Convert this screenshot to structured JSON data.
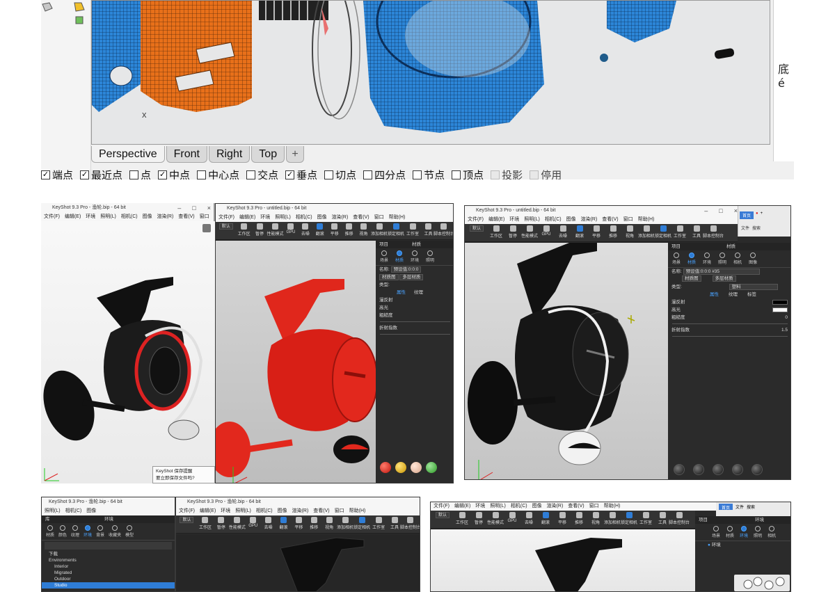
{
  "rhino": {
    "viewport_tabs": [
      "Perspective",
      "Front",
      "Right",
      "Top"
    ],
    "add_tab_glyph": "+",
    "axis_label": "x",
    "right_panel_text": "底é",
    "osnap": [
      {
        "label": "端点",
        "checked": true
      },
      {
        "label": "最近点",
        "checked": true
      },
      {
        "label": "点",
        "checked": false
      },
      {
        "label": "中点",
        "checked": true
      },
      {
        "label": "中心点",
        "checked": false
      },
      {
        "label": "交点",
        "checked": false
      },
      {
        "label": "垂点",
        "checked": true
      },
      {
        "label": "切点",
        "checked": false
      },
      {
        "label": "四分点",
        "checked": false
      },
      {
        "label": "节点",
        "checked": false
      },
      {
        "label": "顶点",
        "checked": false
      },
      {
        "label": "投影",
        "checked": false,
        "disabled": true
      },
      {
        "label": "停用",
        "checked": false,
        "disabled": true
      }
    ],
    "colors": {
      "orange_mesh": "#e8701a",
      "blue_mesh": "#2c86d8",
      "viewport_bg": "#e6e7e8"
    }
  },
  "ks1": {
    "title_left": "KeyShot 9.3 Pro - 渔轮.bip - 64 bit",
    "title_right": "KeyShot 9.3 Pro - untitled.bip - 64 bit",
    "menu_left": [
      "文件(F)",
      "编辑(E)",
      "环境",
      "照明(L)",
      "相机(C)",
      "图像",
      "渲染(R)",
      "查看(V)",
      "窗口"
    ],
    "menu_right": [
      "文件(F)",
      "编辑(E)",
      "环境",
      "照明(L)",
      "相机(C)",
      "图像",
      "渲染(R)",
      "查看(V)",
      "窗口",
      "帮助(H)"
    ],
    "toolbar": {
      "default_label": "默认",
      "resolution": "50.0",
      "buttons": [
        "工作区",
        "暂停",
        "性能模式",
        "GPU",
        "去噪",
        "翻滚",
        "平移",
        "推移",
        "视角",
        "添加相机",
        "锁定相机",
        "工作室",
        "工具",
        "脚本控制台"
      ]
    },
    "panel": {
      "header": "项目",
      "title": "材质",
      "tabs": [
        "场景",
        "材质",
        "环境",
        "照明"
      ],
      "name_label": "名称:",
      "name_value": "预设值:0:0:0",
      "graph_button": "材质图",
      "multi_button": "多层材质",
      "type_label": "类型:",
      "type_value": "塑料",
      "sub_tabs": [
        "属性",
        "纹理",
        "标签"
      ],
      "props": [
        "漫反射",
        "高光",
        "粗糙度",
        "折射指数"
      ]
    },
    "notice": {
      "line1": "KeyShot 保存提醒",
      "line2": "要立即保存文件吗?"
    }
  },
  "ks2": {
    "title": "KeyShot 9.3 Pro - untitled.bip - 64 bit",
    "menu": [
      "文件(F)",
      "编辑(E)",
      "环境",
      "照明(L)",
      "相机(C)",
      "图像",
      "渲染(R)",
      "查看(V)",
      "窗口",
      "帮助(H)"
    ],
    "browser_tabs": [
      "首页",
      "文件",
      "搜索"
    ],
    "panel": {
      "header": "项目",
      "title": "材质",
      "tabs": [
        "场景",
        "材质",
        "环境",
        "照明",
        "相机",
        "图像"
      ],
      "name_label": "名称:",
      "name_value": "预设值:0:0:0 #35",
      "graph_button": "材质图",
      "multi_button": "多层材质",
      "type_label": "类型:",
      "type_value": "塑料",
      "sub_tabs": [
        "属性",
        "纹理",
        "标签"
      ],
      "props": [
        {
          "label": "漫反射",
          "value": ""
        },
        {
          "label": "高光",
          "value": ""
        },
        {
          "label": "粗糙度",
          "value": "0"
        },
        {
          "label": "折射指数",
          "value": "1.5"
        }
      ]
    }
  },
  "ks3": {
    "title_left": "KeyShot 9.3 Pro - 渔轮.bip - 64 bit",
    "title_right": "KeyShot 9.3 Pro - 渔轮.bip - 64 bit",
    "menu_left": [
      "照明(L)",
      "相机(C)",
      "图像"
    ],
    "menu_right": [
      "文件(F)",
      "编辑(E)",
      "环境",
      "照明(L)",
      "相机(C)",
      "图像",
      "渲染(R)",
      "查看(V)",
      "窗口",
      "帮助(H)"
    ],
    "panel": {
      "header": "库",
      "title": "环境",
      "tabs": [
        "材质",
        "颜色",
        "纹理",
        "环境",
        "背景",
        "收藏夹",
        "模型"
      ],
      "tree": [
        "下载",
        "Environments",
        "Interior",
        "Migrated",
        "Outdoor",
        "Studio"
      ]
    }
  },
  "ks4": {
    "menu": [
      "文件(F)",
      "编辑(E)",
      "环境",
      "照明(L)",
      "相机(C)",
      "图像",
      "渲染(R)",
      "查看(V)",
      "窗口",
      "帮助(H)"
    ],
    "browser_tabs": [
      "首页",
      "文件",
      "搜索"
    ],
    "panel": {
      "header": "项目",
      "title": "环境",
      "tabs": [
        "场景",
        "材质",
        "环境",
        "照明",
        "相机"
      ],
      "env_item": "环境"
    }
  }
}
